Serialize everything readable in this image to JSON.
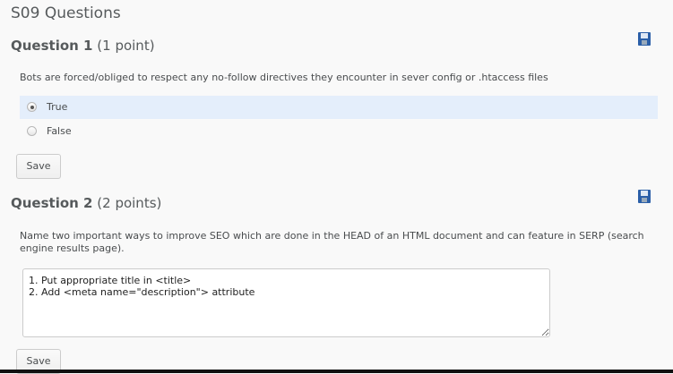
{
  "page_title": "S09 Questions",
  "questions": [
    {
      "label": "Question 1",
      "points": "(1 point)",
      "text": "Bots are forced/obliged to respect any no-follow directives they encounter in sever config or .htaccess files",
      "options": [
        {
          "label": "True",
          "selected": true
        },
        {
          "label": "False",
          "selected": false
        }
      ],
      "save_label": "Save"
    },
    {
      "label": "Question 2",
      "points": "(2 points)",
      "text": "Name two important ways to improve SEO which are done in the HEAD of an HTML document and can feature in SERP (search engine results page).",
      "answer": "1. Put appropriate title in <title>\n2. Add <meta name=\"description\"> attribute",
      "save_label": "Save"
    }
  ],
  "colors": {
    "floppy": "#2b5fa8",
    "selected_bg": "#e4eefb"
  }
}
